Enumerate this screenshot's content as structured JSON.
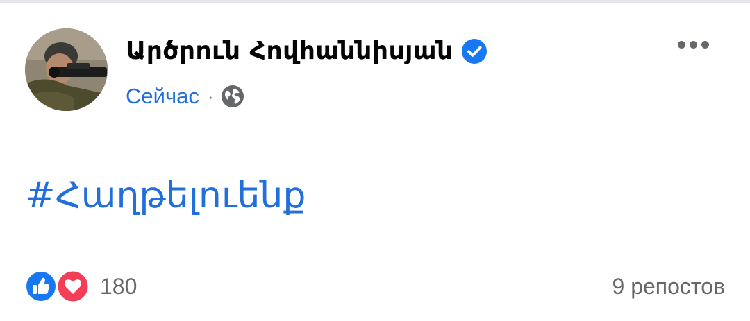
{
  "post": {
    "author": {
      "name": "Արծրուն Հովհաննիսյան",
      "verified": true,
      "avatar_icon": "profile-photo"
    },
    "timestamp": "Сейчас",
    "separator": "·",
    "audience_icon": "globe-icon",
    "hashtag": "#Հաղթելուենք",
    "more_icon": "more-options-icon"
  },
  "footer": {
    "reaction_icons": [
      "like-icon",
      "love-icon"
    ],
    "reaction_count": "180",
    "shares": "9 репостов"
  },
  "colors": {
    "link_blue": "#216fdb",
    "text_dark": "#050505",
    "text_gray": "#65676b",
    "verified_blue": "#1877f2",
    "love_red": "#f33e58"
  }
}
